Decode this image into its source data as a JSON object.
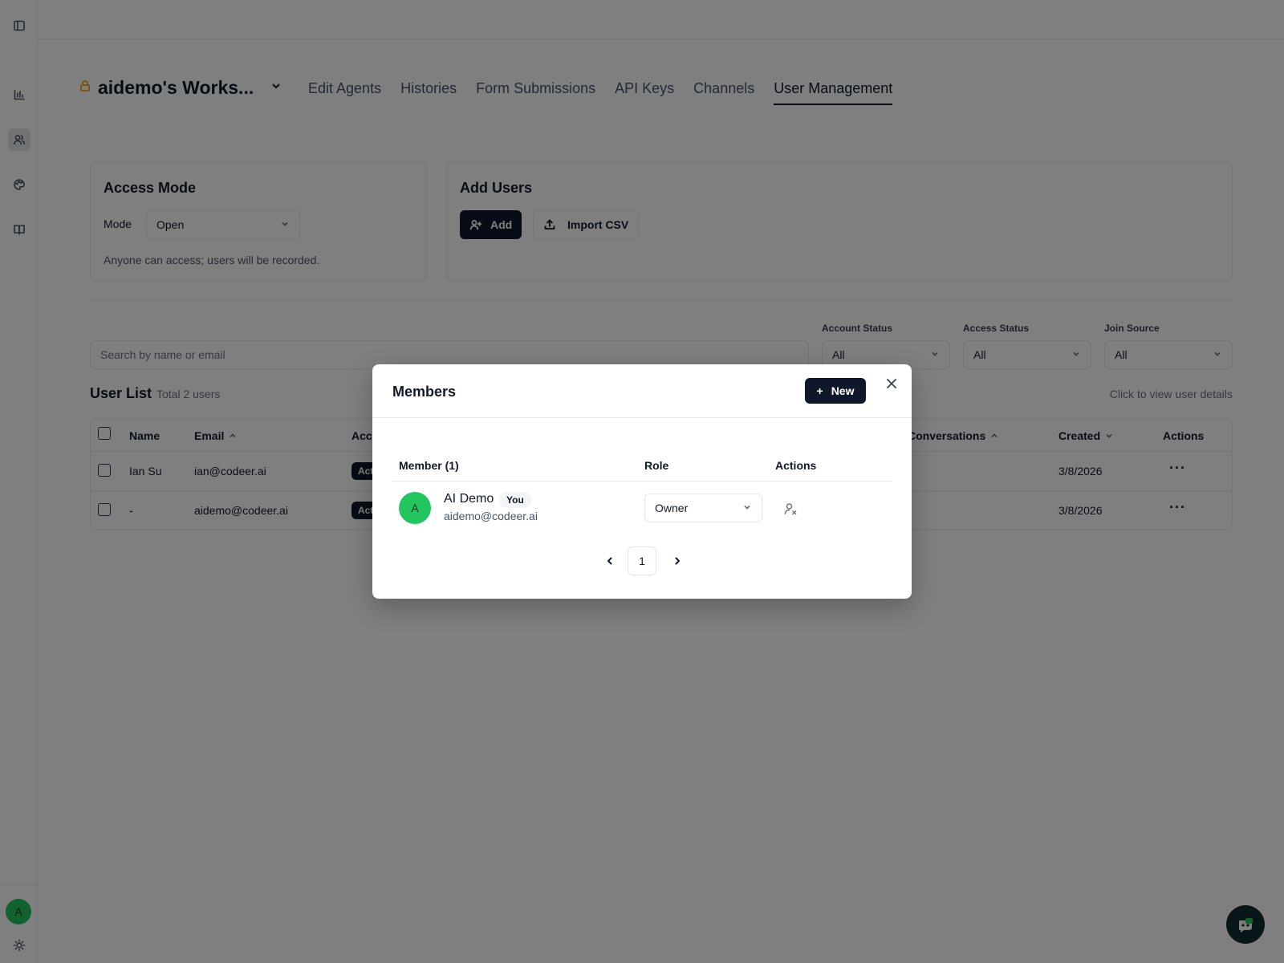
{
  "workspace": {
    "name": "aidemo's Works..."
  },
  "nav": {
    "tabs": [
      {
        "label": "Edit Agents"
      },
      {
        "label": "Histories"
      },
      {
        "label": "Form Submissions"
      },
      {
        "label": "API Keys"
      },
      {
        "label": "Channels"
      },
      {
        "label": "User Management",
        "active": true
      }
    ]
  },
  "access_mode": {
    "title": "Access Mode",
    "mode_label": "Mode",
    "mode_value": "Open",
    "description": "Anyone can access; users will be recorded."
  },
  "add_users": {
    "title": "Add Users",
    "add_label": "Add",
    "import_label": "Import CSV"
  },
  "search": {
    "placeholder": "Search by name or email"
  },
  "filters": {
    "account_status": {
      "label": "Account Status",
      "value": "All"
    },
    "access_status": {
      "label": "Access Status",
      "value": "All"
    },
    "join_source": {
      "label": "Join Source",
      "value": "All"
    }
  },
  "user_list": {
    "title": "User List",
    "total": "Total 2 users",
    "hint": "Click to view user details",
    "columns": {
      "name": "Name",
      "email": "Email",
      "account": "Acc",
      "conversations": "Conversations",
      "created": "Created",
      "actions": "Actions"
    },
    "rows": [
      {
        "name": "Ian Su",
        "email": "ian@codeer.ai",
        "status": "Act",
        "conversations": "",
        "created": "3/8/2026",
        "more": "···"
      },
      {
        "name": "-",
        "email": "aidemo@codeer.ai",
        "status": "Act",
        "conversations": ")",
        "created": "3/8/2026",
        "more": "···"
      }
    ]
  },
  "members_modal": {
    "title": "Members",
    "new_label": "New",
    "new_plus": "+",
    "columns": {
      "member": "Member (1)",
      "role": "Role",
      "actions": "Actions"
    },
    "members": [
      {
        "initial": "A",
        "name": "AI Demo",
        "you_badge": "You",
        "email": "aidemo@codeer.ai",
        "role": "Owner"
      }
    ],
    "pagination": {
      "current_page": "1"
    }
  },
  "sidebar": {
    "icons": [
      "panel-toggle-icon",
      "analytics-icon",
      "users-icon",
      "palette-icon",
      "book-icon"
    ],
    "avatar_initial": "A",
    "bottom_icon": "sun-icon"
  },
  "colors": {
    "primary_dark": "#0f172a",
    "avatar_green": "#22c55e",
    "lock_amber": "#f59e0b",
    "overlay": "rgba(0,0,0,0.5)"
  }
}
